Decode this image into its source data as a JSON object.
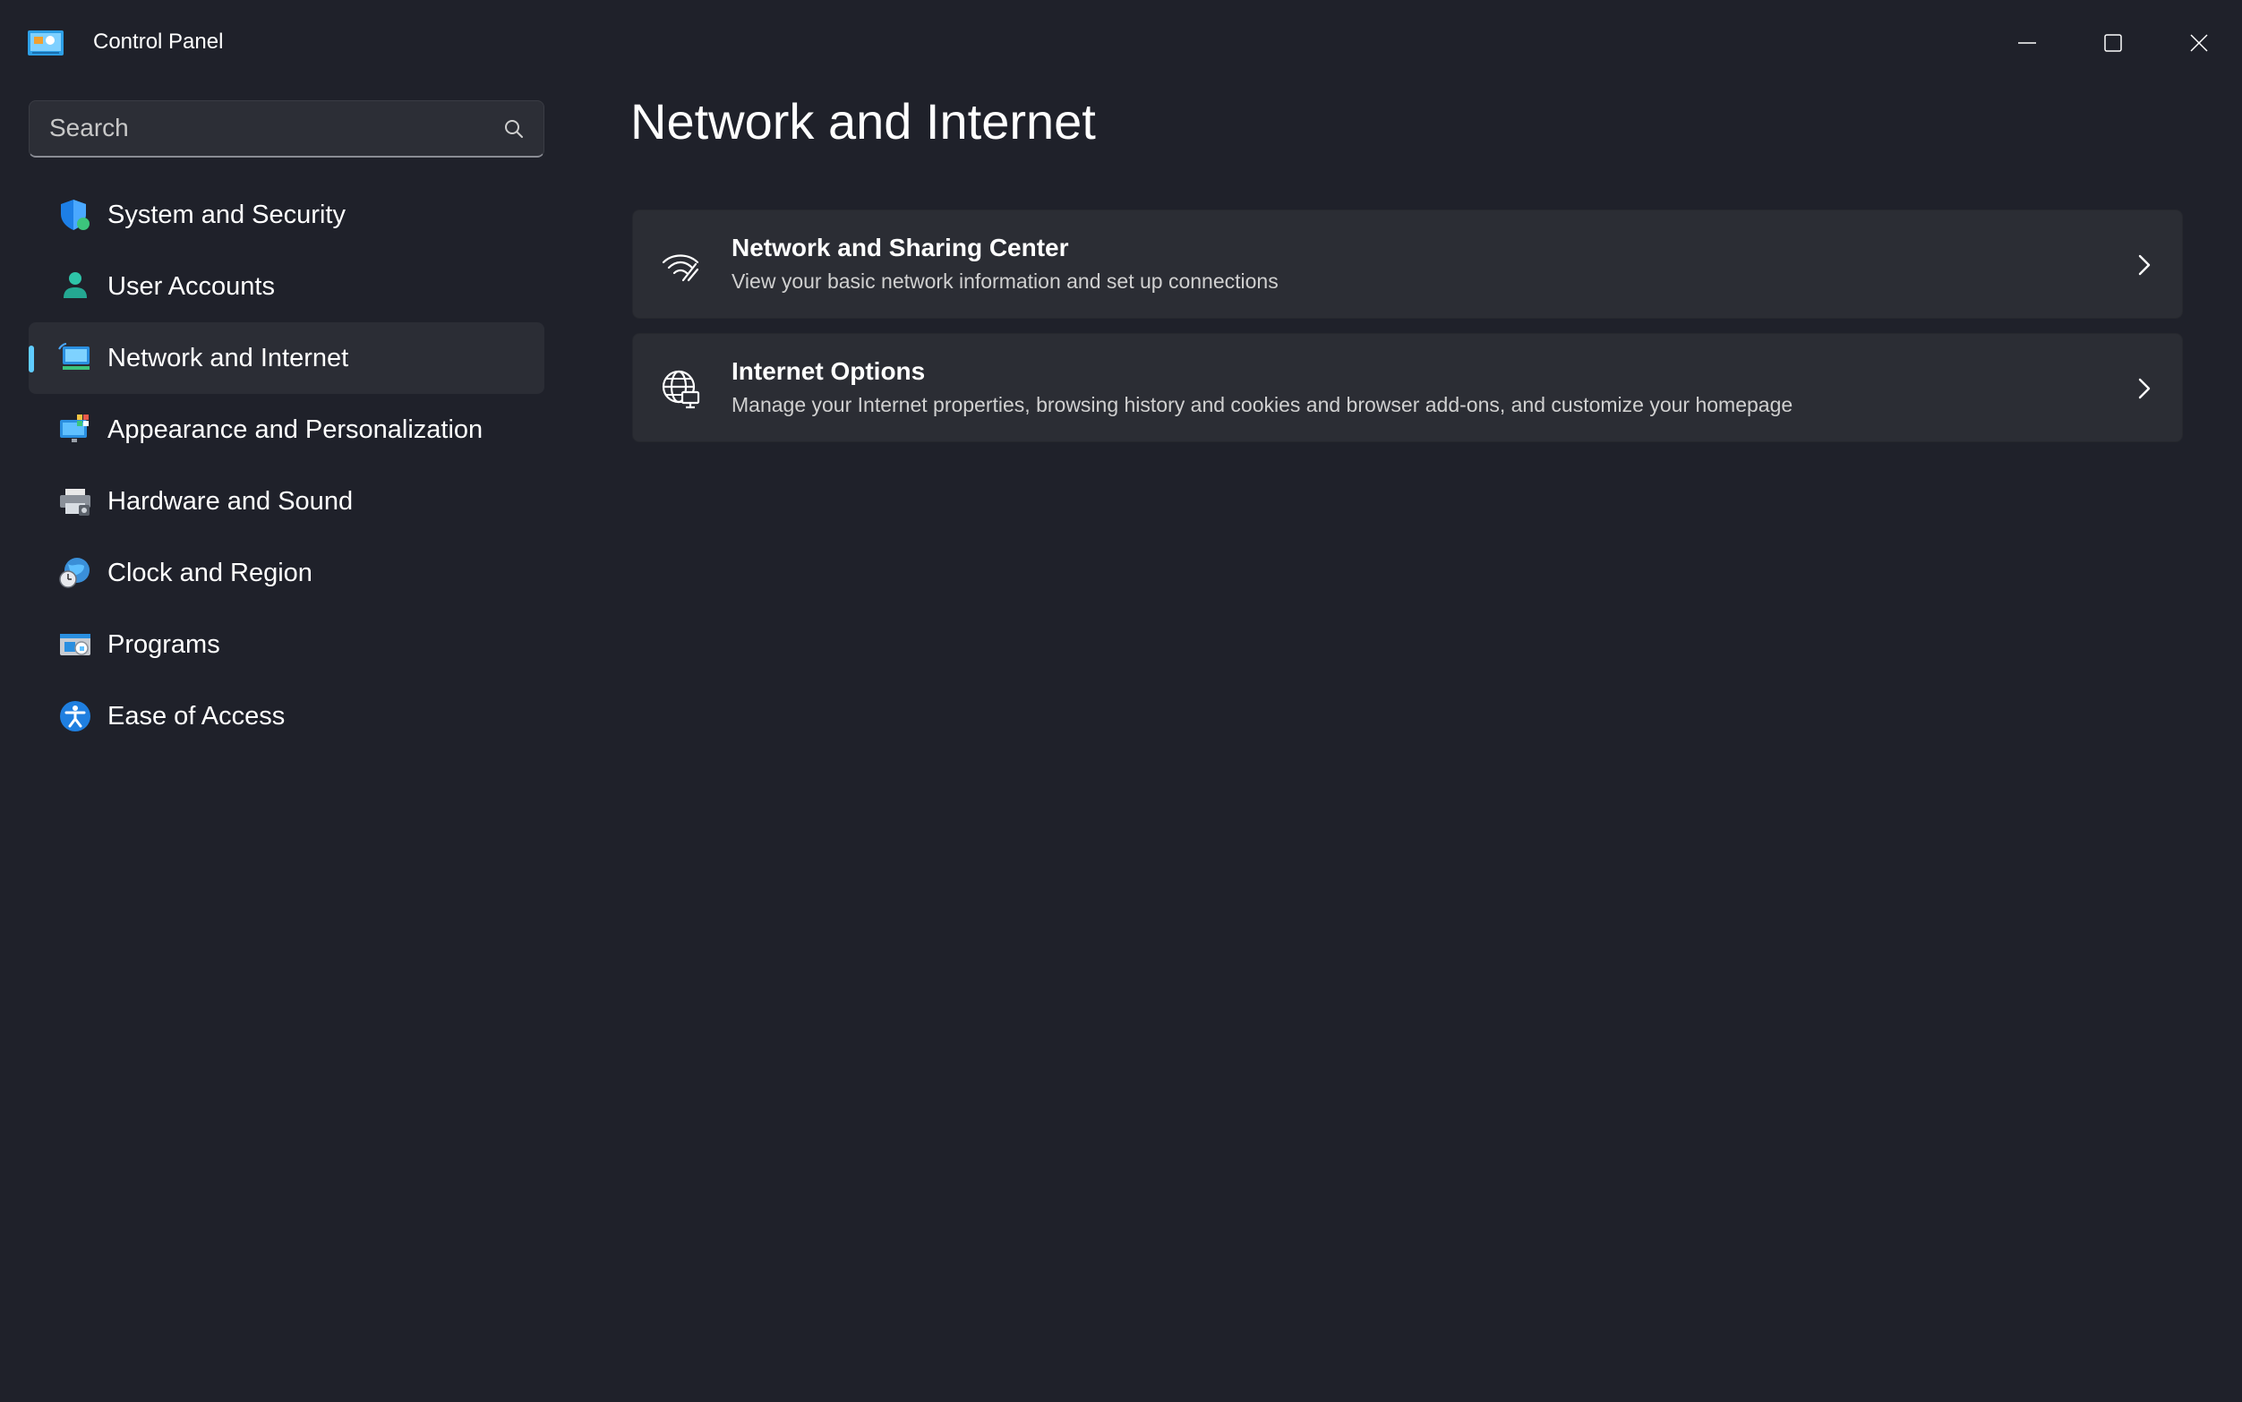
{
  "window": {
    "title": "Control Panel",
    "app_icon": "control-panel-icon",
    "controls": [
      "minimize-icon",
      "maximize-icon",
      "close-icon"
    ]
  },
  "search": {
    "placeholder": "Search",
    "value": "",
    "icon": "search-icon"
  },
  "sidebar": {
    "items": [
      {
        "label": "System and Security",
        "icon": "shield-icon",
        "selected": false
      },
      {
        "label": "User Accounts",
        "icon": "user-icon",
        "selected": false
      },
      {
        "label": "Network and Internet",
        "icon": "network-icon",
        "selected": true
      },
      {
        "label": "Appearance and Personalization",
        "icon": "appearance-icon",
        "selected": false
      },
      {
        "label": "Hardware and Sound",
        "icon": "printer-icon",
        "selected": false
      },
      {
        "label": "Clock and Region",
        "icon": "clock-globe-icon",
        "selected": false
      },
      {
        "label": "Programs",
        "icon": "programs-icon",
        "selected": false
      },
      {
        "label": "Ease of Access",
        "icon": "accessibility-icon",
        "selected": false
      }
    ]
  },
  "main": {
    "title": "Network and Internet",
    "cards": [
      {
        "title": "Network and Sharing Center",
        "description": "View your basic network information and set up connections",
        "icon": "network-sharing-icon"
      },
      {
        "title": "Internet Options",
        "description": "Manage your Internet properties, browsing history and cookies and browser add-ons, and customize your homepage",
        "icon": "globe-icon"
      }
    ]
  },
  "colors": {
    "background": "#1f212a",
    "card": "#2b2d34",
    "selected_item": "#2b2d35",
    "accent": "#60cdff"
  }
}
